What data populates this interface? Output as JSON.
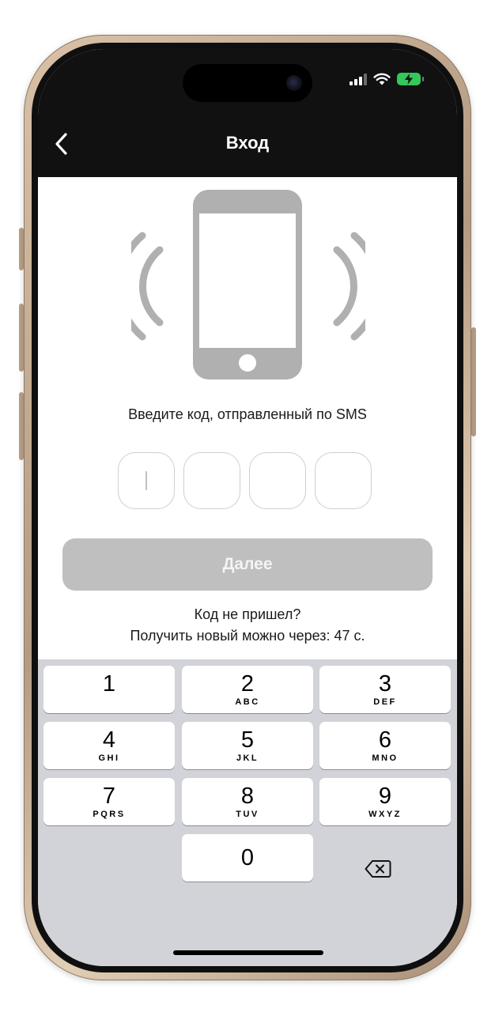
{
  "header": {
    "title": "Вход"
  },
  "content": {
    "prompt": "Введите код, отправленный по SMS",
    "next_label": "Далее",
    "resend_line1": "Код не пришел?",
    "resend_line2": "Получить новый можно через: 47 с."
  },
  "code_inputs": [
    "",
    "",
    "",
    ""
  ],
  "keypad": {
    "keys": [
      {
        "digit": "1",
        "letters": ""
      },
      {
        "digit": "2",
        "letters": "ABC"
      },
      {
        "digit": "3",
        "letters": "DEF"
      },
      {
        "digit": "4",
        "letters": "GHI"
      },
      {
        "digit": "5",
        "letters": "JKL"
      },
      {
        "digit": "6",
        "letters": "MNO"
      },
      {
        "digit": "7",
        "letters": "PQRS"
      },
      {
        "digit": "8",
        "letters": "TUV"
      },
      {
        "digit": "9",
        "letters": "WXYZ"
      },
      {
        "digit": "0",
        "letters": ""
      }
    ]
  },
  "colors": {
    "header_bg": "#111111",
    "disabled_button": "#bfbfbf",
    "illustration_gray": "#b0b0b0",
    "keypad_bg": "#d1d3d9",
    "battery_green": "#34c759"
  },
  "icons": {
    "back": "chevron-left-icon",
    "backspace": "delete-left-icon",
    "illustration": "vibrating-phone-icon"
  }
}
